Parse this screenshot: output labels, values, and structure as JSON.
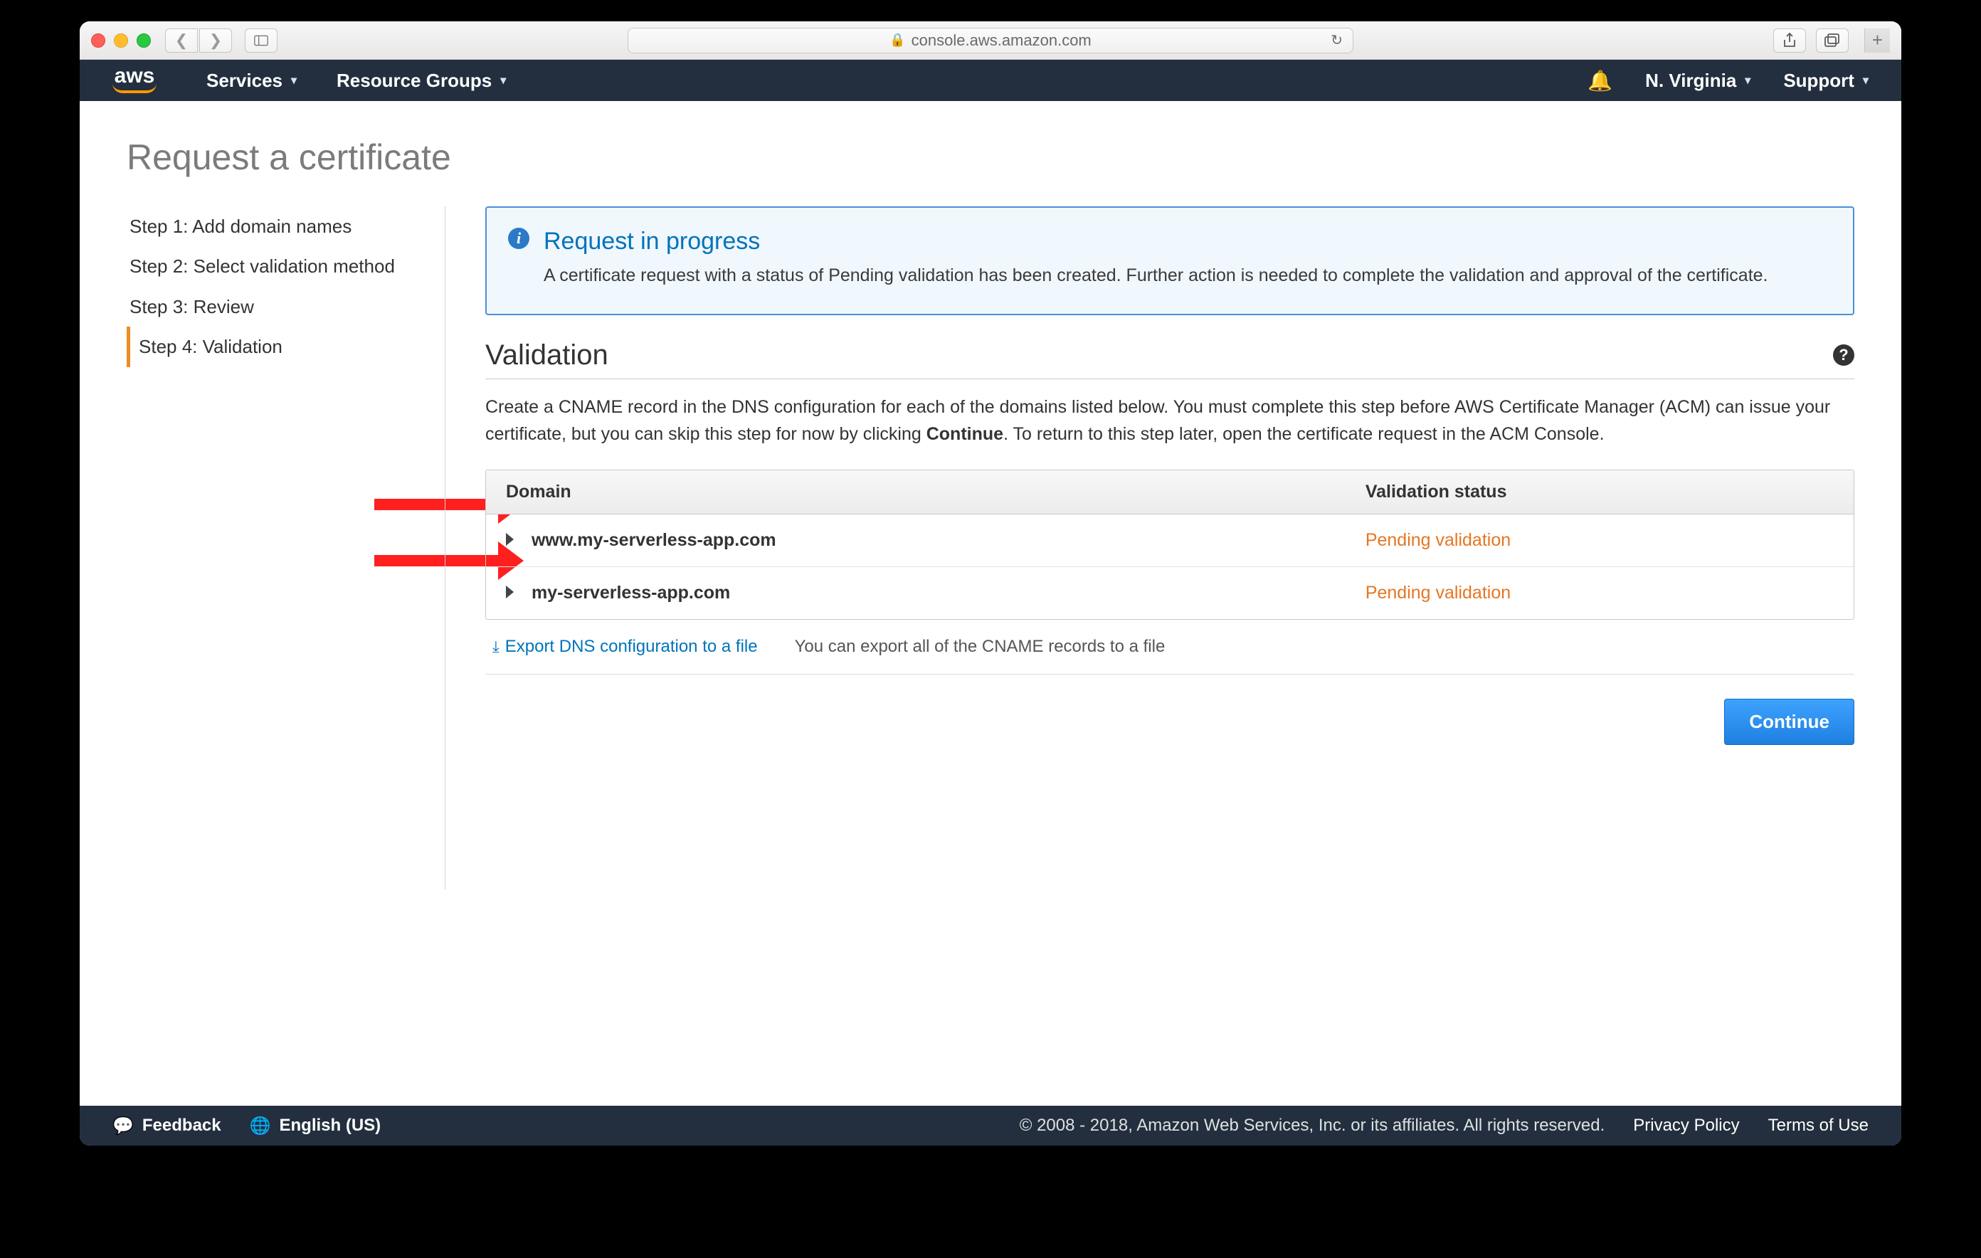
{
  "browser": {
    "url": "console.aws.amazon.com"
  },
  "nav": {
    "logo": "aws",
    "services": "Services",
    "resource_groups": "Resource Groups",
    "region": "N. Virginia",
    "support": "Support"
  },
  "page": {
    "title": "Request a certificate"
  },
  "sidebar": {
    "steps": [
      {
        "label": "Step 1: Add domain names",
        "active": false
      },
      {
        "label": "Step 2: Select validation method",
        "active": false
      },
      {
        "label": "Step 3: Review",
        "active": false
      },
      {
        "label": "Step 4: Validation",
        "active": true
      }
    ]
  },
  "info": {
    "title": "Request in progress",
    "body": "A certificate request with a status of Pending validation has been created. Further action is needed to complete the validation and approval of the certificate."
  },
  "validation": {
    "heading": "Validation",
    "description_pre": "Create a CNAME record in the DNS configuration for each of the domains listed below. You must complete this step before AWS Certificate Manager (ACM) can issue your certificate, but you can skip this step for now by clicking ",
    "description_bold": "Continue",
    "description_post": ". To return to this step later, open the certificate request in the ACM Console.",
    "col_domain": "Domain",
    "col_status": "Validation status",
    "rows": [
      {
        "domain": "www.my-serverless-app.com",
        "status": "Pending validation"
      },
      {
        "domain": "my-serverless-app.com",
        "status": "Pending validation"
      }
    ],
    "export_link": "Export DNS configuration to a file",
    "export_note": "You can export all of the CNAME records to a file"
  },
  "actions": {
    "continue": "Continue"
  },
  "footer": {
    "feedback": "Feedback",
    "language": "English (US)",
    "copyright": "© 2008 - 2018, Amazon Web Services, Inc. or its affiliates. All rights reserved.",
    "privacy": "Privacy Policy",
    "terms": "Terms of Use"
  }
}
